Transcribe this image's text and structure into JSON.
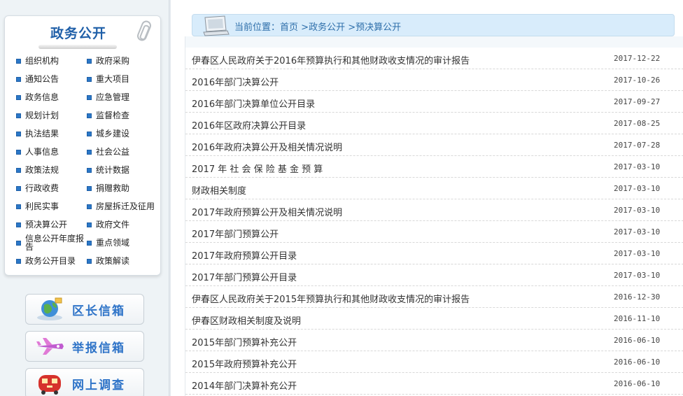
{
  "sidebar": {
    "title": "政务公开",
    "menu": [
      {
        "label": "组织机构"
      },
      {
        "label": "政府采购"
      },
      {
        "label": "通知公告"
      },
      {
        "label": "重大项目"
      },
      {
        "label": "政务信息"
      },
      {
        "label": "应急管理"
      },
      {
        "label": "规划计划"
      },
      {
        "label": "监督检查"
      },
      {
        "label": "执法结果"
      },
      {
        "label": "城乡建设"
      },
      {
        "label": "人事信息"
      },
      {
        "label": "社会公益"
      },
      {
        "label": "政策法规"
      },
      {
        "label": "统计数据"
      },
      {
        "label": "行政收费"
      },
      {
        "label": "捐赠救助"
      },
      {
        "label": "利民实事"
      },
      {
        "label": "房屋拆迁及征用"
      },
      {
        "label": "预决算公开"
      },
      {
        "label": "政府文件"
      },
      {
        "label": "信息公开年度报告"
      },
      {
        "label": "重点领域"
      },
      {
        "label": "政务公开目录"
      },
      {
        "label": "政策解读"
      }
    ],
    "buttons": [
      {
        "label": "区长信箱",
        "icon": "globe-icon"
      },
      {
        "label": "举报信箱",
        "icon": "airplane-icon"
      },
      {
        "label": "网上调查",
        "icon": "train-icon"
      }
    ]
  },
  "breadcrumb": {
    "prefix": "当前位置：",
    "items": [
      "首页",
      ">政务公开",
      ">预决算公开"
    ]
  },
  "articles": [
    {
      "title": "伊春区人民政府关于2016年预算执行和其他财政收支情况的审计报告",
      "date": "2017-12-22"
    },
    {
      "title": "2016年部门决算公开",
      "date": "2017-10-26"
    },
    {
      "title": "2016年部门决算单位公开目录",
      "date": "2017-09-27"
    },
    {
      "title": "2016年区政府决算公开目录",
      "date": "2017-08-25"
    },
    {
      "title": "2016年政府决算公开及相关情况说明",
      "date": "2017-07-28"
    },
    {
      "title": "2017 年 社 会 保 险 基 金 预 算",
      "date": "2017-03-10"
    },
    {
      "title": "财政相关制度",
      "date": "2017-03-10"
    },
    {
      "title": "2017年政府预算公开及相关情况说明",
      "date": "2017-03-10"
    },
    {
      "title": "2017年部门预算公开",
      "date": "2017-03-10"
    },
    {
      "title": "2017年政府预算公开目录",
      "date": "2017-03-10"
    },
    {
      "title": "2017年部门预算公开目录",
      "date": "2017-03-10"
    },
    {
      "title": "伊春区人民政府关于2015年预算执行和其他财政收支情况的审计报告",
      "date": "2016-12-30"
    },
    {
      "title": "伊春区财政相关制度及说明",
      "date": "2016-11-10"
    },
    {
      "title": "2015年部门预算补充公开",
      "date": "2016-06-10"
    },
    {
      "title": "2015年政府预算补充公开",
      "date": "2016-06-10"
    },
    {
      "title": "2014年部门决算补充公开",
      "date": "2016-06-10"
    }
  ]
}
